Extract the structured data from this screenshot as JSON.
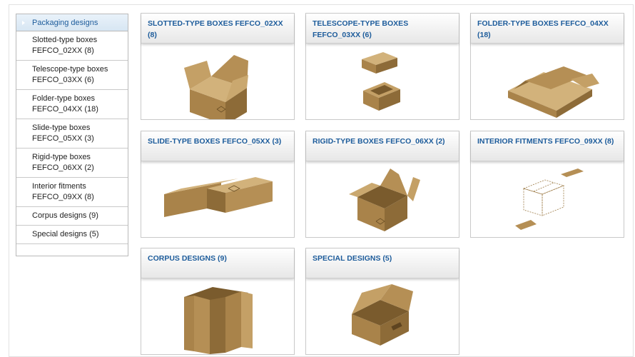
{
  "sidebar": {
    "header": "Packaging designs",
    "items": [
      {
        "line1": "Slotted-type boxes",
        "line2": "FEFCO_02XX (8)"
      },
      {
        "line1": "Telescope-type boxes",
        "line2": "FEFCO_03XX (6)"
      },
      {
        "line1": "Folder-type boxes",
        "line2": "FEFCO_04XX (18)"
      },
      {
        "line1": "Slide-type boxes",
        "line2": "FEFCO_05XX (3)"
      },
      {
        "line1": "Rigid-type boxes",
        "line2": "FEFCO_06XX (2)"
      },
      {
        "line1": "Interior fitments",
        "line2": "FEFCO_09XX (8)"
      },
      {
        "line1": "Corpus designs (9)",
        "line2": ""
      },
      {
        "line1": "Special designs (5)",
        "line2": ""
      }
    ]
  },
  "cards": [
    {
      "title": "SLOTTED-TYPE BOXES FEFCO_02XX (8)",
      "icon": "slotted-box-icon"
    },
    {
      "title": "TELESCOPE-TYPE BOXES FEFCO_03XX (6)",
      "icon": "telescope-box-icon"
    },
    {
      "title": "FOLDER-TYPE BOXES FEFCO_04XX (18)",
      "icon": "folder-box-icon"
    },
    {
      "title": "SLIDE-TYPE BOXES FEFCO_05XX (3)",
      "icon": "slide-box-icon"
    },
    {
      "title": "RIGID-TYPE BOXES FEFCO_06XX (2)",
      "icon": "rigid-box-icon"
    },
    {
      "title": "INTERIOR FITMENTS FEFCO_09XX (8)",
      "icon": "interior-fitment-icon"
    },
    {
      "title": "CORPUS DESIGNS (9)",
      "icon": "corpus-box-icon"
    },
    {
      "title": "SPECIAL DESIGNS (5)",
      "icon": "special-box-icon"
    }
  ],
  "colors": {
    "link_blue": "#1d5c9b",
    "cardboard": "#b58f55",
    "cardboard_dark": "#8d6b38",
    "cardboard_light": "#d2b27b"
  }
}
